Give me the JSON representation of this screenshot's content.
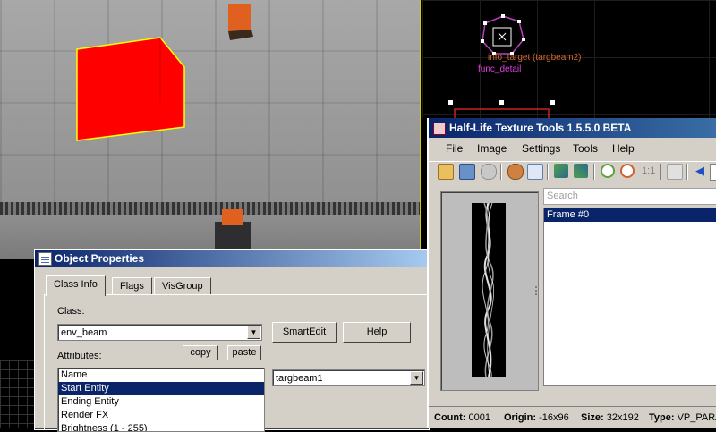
{
  "viewport_2d": {
    "entity_label": "info_target (targbeam2)",
    "brush_label": "func_detail",
    "entity_label_color": "#d86a2a",
    "brush_label_color": "#e040e0"
  },
  "object_properties": {
    "title": "Object Properties",
    "tabs": [
      "Class Info",
      "Flags",
      "VisGroup"
    ],
    "class_label": "Class:",
    "class_value": "env_beam",
    "smartedit_label": "SmartEdit",
    "help_label": "Help",
    "copy_label": "copy",
    "paste_label": "paste",
    "attributes_label": "Attributes:",
    "attributes": [
      "Name",
      "Start Entity",
      "Ending Entity",
      "Render FX",
      "Brightness (1 - 255)"
    ],
    "selected_attribute_index": 1,
    "value": "targbeam1"
  },
  "hltt": {
    "title": "Half-Life Texture Tools 1.5.5.0 BETA",
    "menu": [
      "File",
      "Image",
      "Settings",
      "Tools",
      "Help"
    ],
    "zoom_label": "1:1",
    "search_placeholder": "Search",
    "frames": [
      "Frame #0"
    ],
    "status": {
      "count_label": "Count:",
      "count_value": "0001",
      "origin_label": "Origin:",
      "origin_value": "-16x96",
      "size_label": "Size:",
      "size_value": "32x192",
      "type_label": "Type:",
      "type_value": "VP_PARA"
    }
  },
  "colors": {
    "selection": "#0a246a",
    "cube_red": "#ff0000",
    "cube_outline": "#ffff00",
    "orange": "#e06020"
  }
}
